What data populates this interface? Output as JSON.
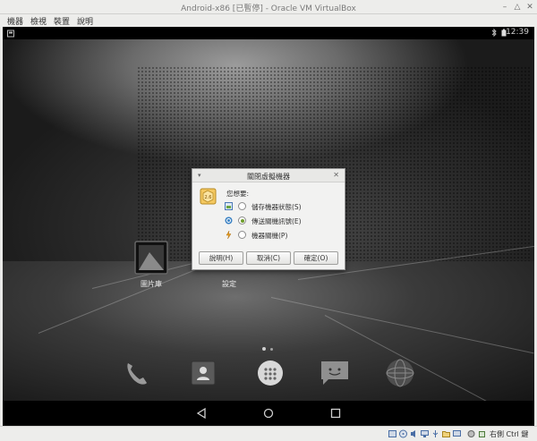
{
  "window": {
    "title": "Android-x86 [已暫停] - Oracle VM VirtualBox"
  },
  "menubar": {
    "items": [
      "機器",
      "檢視",
      "裝置",
      "說明"
    ]
  },
  "android": {
    "clock": "12:39",
    "apps": [
      {
        "label": "圖片庫"
      },
      {
        "label": "設定"
      }
    ],
    "dock_icons": [
      "phone-icon",
      "contacts-icon",
      "app-drawer-icon",
      "messaging-icon",
      "browser-icon"
    ],
    "nav_icons": [
      "back-icon",
      "home-icon",
      "recents-icon"
    ]
  },
  "dialog": {
    "title": "關閉虛擬機器",
    "prompt": "您想要:",
    "options": [
      {
        "label": "儲存機器狀態(S)",
        "selected": false,
        "icon": "save-state-icon"
      },
      {
        "label": "傳送關機訊號(E)",
        "selected": true,
        "icon": "acpi-shutdown-icon"
      },
      {
        "label": "機器關機(P)",
        "selected": false,
        "icon": "power-off-icon"
      }
    ],
    "buttons": {
      "help": "說明(H)",
      "cancel": "取消(C)",
      "ok": "確定(O)"
    }
  },
  "statusbar": {
    "hostkey": "右側 Ctrl 鍵"
  }
}
